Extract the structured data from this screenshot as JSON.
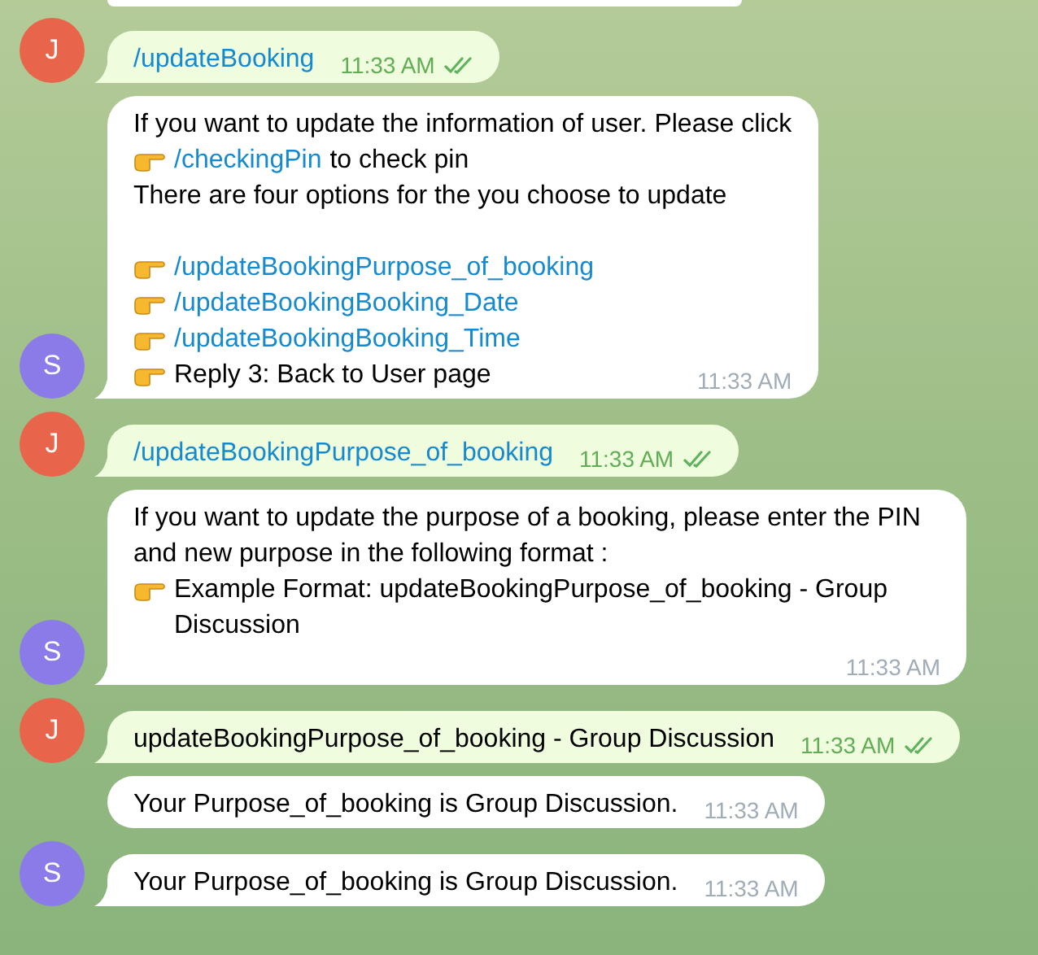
{
  "messages": [
    {
      "outgoing": true,
      "time": "11:33 AM",
      "read": true,
      "avatar": {
        "letter": "J",
        "color": "#e8654b"
      },
      "lines": [
        {
          "kind": "line",
          "parts": [
            {
              "kind": "link",
              "text": "/updateBooking"
            }
          ]
        }
      ]
    },
    {
      "outgoing": false,
      "time": "11:33 AM",
      "avatar": {
        "letter": "S",
        "color": "#8a7be8"
      },
      "lines": [
        {
          "kind": "line",
          "parts": [
            {
              "kind": "text",
              "text": "If you want to update the information of user. Please click"
            }
          ]
        },
        {
          "kind": "line",
          "parts": [
            {
              "kind": "hand"
            },
            {
              "kind": "link",
              "text": "/checkingPin"
            },
            {
              "kind": "text",
              "text": "to check pin"
            }
          ]
        },
        {
          "kind": "line",
          "parts": [
            {
              "kind": "text",
              "text": "There are four options for the you choose to update"
            }
          ]
        },
        {
          "kind": "spacer"
        },
        {
          "kind": "line",
          "parts": [
            {
              "kind": "hand"
            },
            {
              "kind": "link",
              "text": "/updateBookingPurpose_of_booking"
            }
          ]
        },
        {
          "kind": "line",
          "parts": [
            {
              "kind": "hand"
            },
            {
              "kind": "link",
              "text": "/updateBookingBooking_Date"
            }
          ]
        },
        {
          "kind": "line",
          "parts": [
            {
              "kind": "hand"
            },
            {
              "kind": "link",
              "text": "/updateBookingBooking_Time"
            }
          ]
        },
        {
          "kind": "line",
          "parts": [
            {
              "kind": "hand"
            },
            {
              "kind": "text",
              "text": "Reply 3: Back to User page"
            }
          ]
        }
      ]
    },
    {
      "outgoing": true,
      "time": "11:33 AM",
      "read": true,
      "avatar": {
        "letter": "J",
        "color": "#e8654b"
      },
      "lines": [
        {
          "kind": "line",
          "parts": [
            {
              "kind": "link",
              "text": "/updateBookingPurpose_of_booking"
            }
          ]
        }
      ]
    },
    {
      "outgoing": false,
      "time": "11:33 AM",
      "avatar": {
        "letter": "S",
        "color": "#8a7be8"
      },
      "lines": [
        {
          "kind": "line",
          "parts": [
            {
              "kind": "text",
              "text": "If you want to update the purpose of a booking, please enter the PIN and new purpose in the following format :"
            }
          ]
        },
        {
          "kind": "line",
          "parts": [
            {
              "kind": "hand"
            },
            {
              "kind": "text",
              "text": "Example Format: updateBookingPurpose_of_booking - Group Discussion"
            }
          ]
        }
      ]
    },
    {
      "outgoing": true,
      "time": "11:33 AM",
      "read": true,
      "avatar": {
        "letter": "J",
        "color": "#e8654b"
      },
      "lines": [
        {
          "kind": "line",
          "parts": [
            {
              "kind": "text",
              "text": "updateBookingPurpose_of_booking - Group Discussion"
            }
          ]
        }
      ]
    },
    {
      "outgoing": false,
      "time": "11:33 AM",
      "lines": [
        {
          "kind": "line",
          "parts": [
            {
              "kind": "text",
              "text": "Your Purpose_of_booking is Group Discussion."
            }
          ]
        }
      ]
    },
    {
      "outgoing": false,
      "time": "11:33 AM",
      "avatar": {
        "letter": "S",
        "color": "#8a7be8"
      },
      "lines": [
        {
          "kind": "line",
          "parts": [
            {
              "kind": "text",
              "text": "Your Purpose_of_booking is Group Discussion."
            }
          ]
        }
      ]
    }
  ]
}
